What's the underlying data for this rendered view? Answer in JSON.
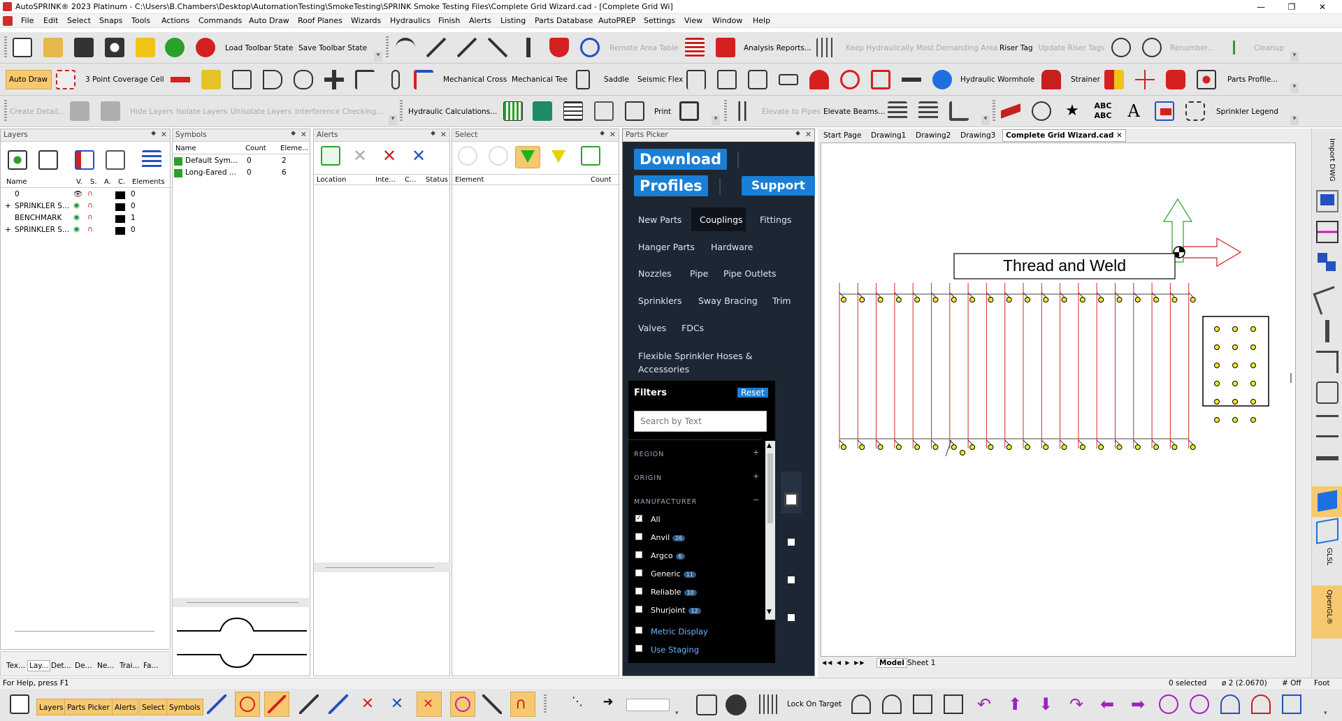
{
  "window": {
    "title": "AutoSPRINK® 2023 Platinum - C:\\Users\\B.Chambers\\Desktop\\AutomationTesting\\SmokeTesting\\SPRINK Smoke Testing Files\\Complete Grid Wizard.cad - [Complete Grid Wi]",
    "minimize": "—",
    "restore": "❐",
    "close": "✕"
  },
  "menu": [
    "File",
    "Edit",
    "Select",
    "Snaps",
    "Tools",
    "Actions",
    "Commands",
    "Auto Draw",
    "Roof Planes",
    "Wizards",
    "Hydraulics",
    "Finish",
    "Alerts",
    "Listing",
    "Parts Database",
    "AutoPREP",
    "Settings",
    "View",
    "Window",
    "Help"
  ],
  "toolbar1": {
    "load_state": "Load Toolbar State",
    "save_state": "Save Toolbar State",
    "remote_area_table": "Remote Area Table",
    "analysis_reports": "Analysis Reports...",
    "keep_hydraulic": "Keep Hydraulically Most Demanding Area",
    "riser_tag": "Riser Tag",
    "update_riser_tags": "Update Riser Tags",
    "renumber": "Renumber...",
    "cleanup": "Cleanup"
  },
  "toolbar2": {
    "auto_draw": "Auto Draw",
    "coverage_cell": "3 Point Coverage Cell",
    "mechanical_cross": "Mechanical Cross",
    "mechanical_tee": "Mechanical Tee",
    "saddle": "Saddle",
    "seismic_flex": "Seismic Flex",
    "hydraulic_wormhole": "Hydraulic Wormhole",
    "strainer": "Strainer",
    "parts_profile": "Parts Profile..."
  },
  "toolbar3": {
    "create_detail": "Create Detail...",
    "hide_layers": "Hide Layers",
    "isolate_layers": "Isolate Layers",
    "unisolate_layers": "Unisolate Layers",
    "interference": "Interference Checking...",
    "hydraulic_calcs": "Hydraulic Calculations...",
    "print": "Print",
    "elevate_to_pipes": "Elevate to Pipes",
    "elevate_beams": "Elevate Beams...",
    "sprinkler_legend": "Sprinkler Legend"
  },
  "layers": {
    "title": "Layers",
    "columns": [
      "Name",
      "V.",
      "S.",
      "A.",
      "C.",
      "Elements"
    ],
    "rows": [
      {
        "name": "0",
        "elements": "0",
        "expand": ""
      },
      {
        "name": "SPRINKLER S...",
        "elements": "0",
        "expand": "+"
      },
      {
        "name": "BENCHMARK",
        "elements": "1",
        "expand": ""
      },
      {
        "name": "SPRINKLER S...",
        "elements": "0",
        "expand": "+"
      }
    ]
  },
  "symbols": {
    "title": "Symbols",
    "columns": [
      "Name",
      "Count",
      "Eleme..."
    ],
    "rows": [
      {
        "name": "Default Sym...",
        "count": "0",
        "elements": "2"
      },
      {
        "name": "Long-Eared ...",
        "count": "0",
        "elements": "6"
      }
    ]
  },
  "alerts": {
    "title": "Alerts",
    "columns": [
      "Location",
      "Inte...",
      "C...",
      "Status"
    ]
  },
  "select": {
    "title": "Select",
    "columns": [
      "Element",
      "Count"
    ]
  },
  "parts_picker": {
    "title": "Parts Picker",
    "download": "Download",
    "profiles": "Profiles",
    "support": "Support",
    "categories": [
      "New Parts",
      "Couplings",
      "Fittings",
      "Hanger Parts",
      "Hardware",
      "Nozzles",
      "Pipe",
      "Pipe Outlets",
      "Sprinklers",
      "Sway Bracing",
      "Trim",
      "Valves",
      "FDCs",
      "Flexible Sprinkler Hoses & Accessories"
    ],
    "active_category": "Couplings",
    "filters": "Filters",
    "reset": "Reset",
    "search_placeholder": "Search by Text",
    "region": "REGION",
    "origin": "ORIGIN",
    "manufacturer": "MANUFACTURER",
    "plus": "+",
    "minus": "−",
    "manufacturers": [
      {
        "name": "All",
        "count": "",
        "checked": true
      },
      {
        "name": "Anvil",
        "count": "26",
        "checked": false
      },
      {
        "name": "Argco",
        "count": "6",
        "checked": false
      },
      {
        "name": "Generic",
        "count": "11",
        "checked": false
      },
      {
        "name": "Reliable",
        "count": "10",
        "checked": false
      },
      {
        "name": "Shurjoint",
        "count": "12",
        "checked": false
      }
    ],
    "metric_display": "Metric Display",
    "use_staging": "Use Staging"
  },
  "doc_tabs": [
    "Start Page",
    "Drawing1",
    "Drawing2",
    "Drawing3",
    "Complete Grid Wizard.cad"
  ],
  "active_doc_tab": "Complete Grid Wizard.cad",
  "drawing": {
    "label": "Thread and Weld"
  },
  "layout_tabs": [
    "Model",
    "Sheet 1"
  ],
  "bottom_panel_tabs": [
    "Tex...",
    "Lay...",
    "Det...",
    "De...",
    "Ne...",
    "Trai...",
    "Fa..."
  ],
  "right_tools": {
    "import_dwg": "Import DWG",
    "glsl": "GLSL",
    "opengl": "OpenGL®"
  },
  "status": {
    "help": "For Help, press F1",
    "selected": "0 selected",
    "diameter": "ø 2 (2.0670)",
    "off": "# Off",
    "units": "Foot"
  },
  "bottom_toolbar": {
    "buttons": [
      "Layers",
      "Parts Picker",
      "Alerts",
      "Select",
      "Symbols"
    ],
    "lock_on_target": "Lock On Target"
  },
  "colors": {
    "accent_orange": "#f6c970",
    "parts_picker_bg": "#1d2633",
    "button_blue": "#1a7fd4",
    "pipe_red": "#d62828",
    "head_yellow": "#f2e81b"
  }
}
